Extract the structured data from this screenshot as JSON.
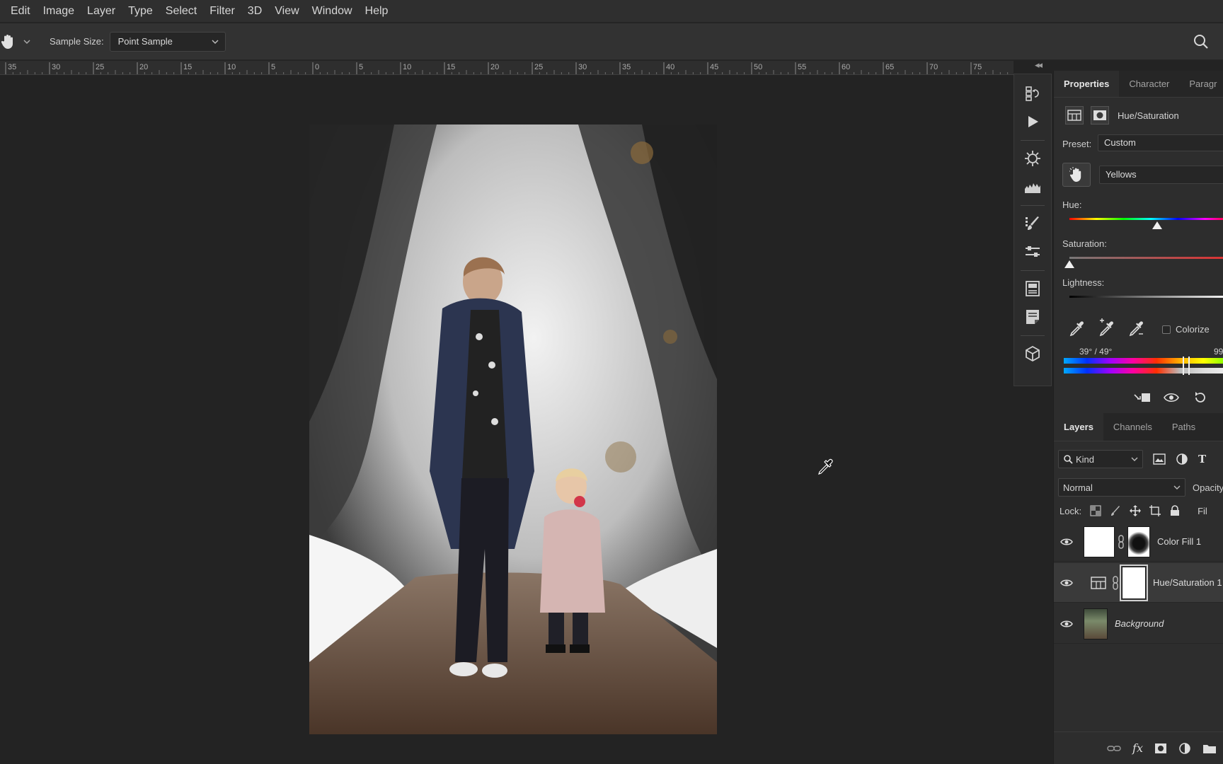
{
  "menu": [
    "Edit",
    "Image",
    "Layer",
    "Type",
    "Select",
    "Filter",
    "3D",
    "View",
    "Window",
    "Help"
  ],
  "options_bar": {
    "sample_size_label": "Sample Size:",
    "sample_size_value": "Point Sample"
  },
  "ruler": {
    "labels": [
      "35",
      "30",
      "25",
      "20",
      "15",
      "10",
      "5",
      "0",
      "5",
      "10",
      "15",
      "20",
      "25",
      "30",
      "35",
      "40",
      "45",
      "50",
      "55",
      "60",
      "65",
      "70",
      "75"
    ]
  },
  "properties": {
    "tabs": [
      "Properties",
      "Character",
      "Paragr"
    ],
    "active_tab": "Properties",
    "adjustment_title": "Hue/Saturation",
    "preset_label": "Preset:",
    "preset_value": "Custom",
    "channel_value": "Yellows",
    "hue_label": "Hue:",
    "saturation_label": "Saturation:",
    "lightness_label": "Lightness:",
    "colorize_label": "Colorize",
    "range_left": "39° / 49°",
    "range_right": "99",
    "hue_position": 0.54,
    "saturation_position": 0.0
  },
  "layers": {
    "tabs": [
      "Layers",
      "Channels",
      "Paths"
    ],
    "active_tab": "Layers",
    "filter_kind": "Kind",
    "blend_mode": "Normal",
    "opacity_label": "Opacity",
    "lock_label": "Lock:",
    "fill_label": "Fil",
    "items": [
      {
        "name": "Color Fill 1",
        "selected": false
      },
      {
        "name": "Hue/Saturation 1",
        "selected": true
      },
      {
        "name": "Background",
        "selected": false
      }
    ]
  },
  "colors": {
    "app_bg": "#232323",
    "panel_bg": "#2d2d2d",
    "menubar_bg": "#2f2f2f"
  }
}
